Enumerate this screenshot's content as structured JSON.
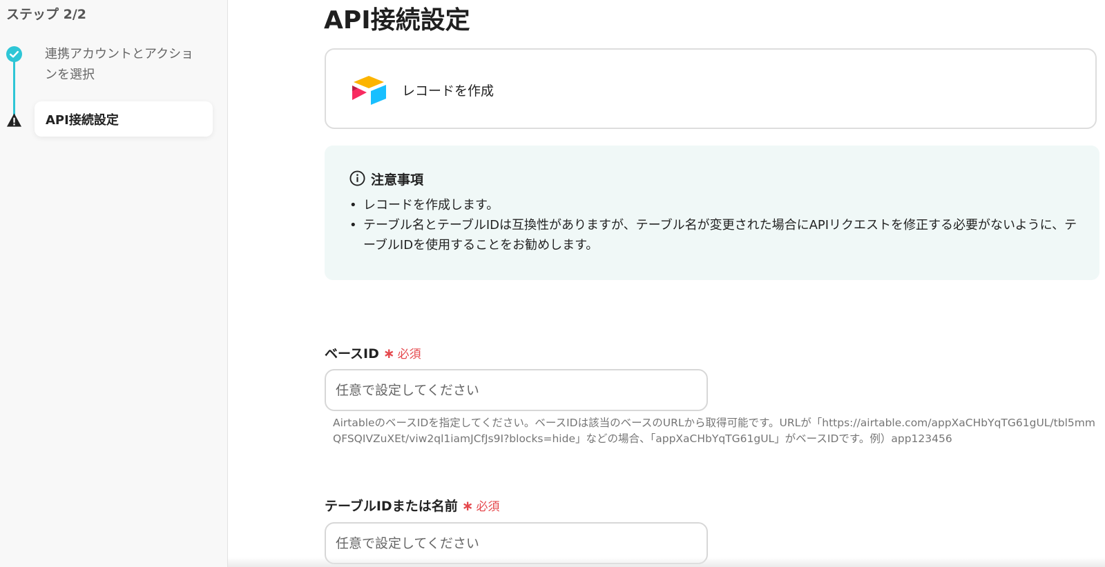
{
  "sidebar": {
    "step_header": "ステップ 2/2",
    "steps": [
      {
        "label": "連携アカウントとアクションを選択",
        "status": "completed"
      },
      {
        "label": "API接続設定",
        "status": "warning"
      }
    ]
  },
  "main": {
    "title": "API接続設定",
    "action": {
      "app_icon": "airtable-icon",
      "label": "レコードを作成"
    },
    "notice": {
      "title": "注意事項",
      "items": [
        "レコードを作成します。",
        "テーブル名とテーブルIDは互換性がありますが、テーブル名が変更された場合にAPIリクエストを修正する必要がないように、テーブルIDを使用することをお勧めします。"
      ]
    },
    "fields": [
      {
        "label": "ベースID",
        "required_mark": "∗",
        "required_text": "必須",
        "value": "",
        "placeholder": "任意で設定してください",
        "help": "AirtableのベースIDを指定してください。ベースIDは該当のベースのURLから取得可能です。URLが「https://airtable.com/appXaCHbYqTG61gUL/tbl5mmQFSQIVZuXEt/viw2ql1iamJCfJs9I?blocks=hide」などの場合、「appXaCHbYqTG61gUL」がベースIDです。例）app123456"
      },
      {
        "label": "テーブルIDまたは名前",
        "required_mark": "∗",
        "required_text": "必須",
        "value": "",
        "placeholder": "任意で設定してください"
      }
    ]
  },
  "colors": {
    "accent": "#2ec6d6",
    "required": "#e5484d",
    "notice_bg": "#f0f8f7",
    "airtable_yellow": "#fcb400",
    "airtable_blue": "#18bfff",
    "airtable_red": "#f82b60"
  }
}
